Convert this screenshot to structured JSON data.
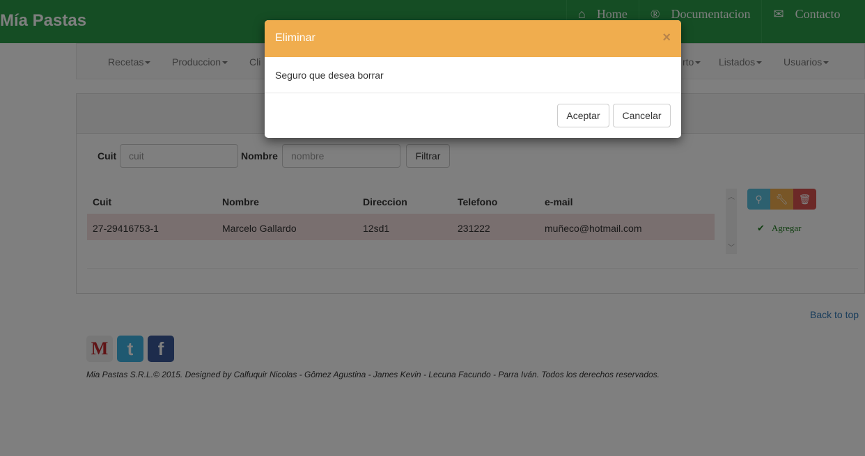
{
  "header": {
    "brand": "Mía Pastas",
    "nav": [
      {
        "icon": "home-icon",
        "label": "Home"
      },
      {
        "icon": "registered-icon",
        "label": "Documentacion"
      },
      {
        "icon": "envelope-icon",
        "label": "Contacto"
      }
    ]
  },
  "subnav": {
    "items": [
      "Recetas",
      "Produccion",
      "Cli",
      "rto",
      "Listados",
      "Usuarios"
    ]
  },
  "filter": {
    "cuit_label": "Cuit",
    "cuit_placeholder": "cuit",
    "nombre_label": "Nombre",
    "nombre_placeholder": "nombre",
    "filter_button": "Filtrar"
  },
  "table": {
    "headers": [
      "Cuit",
      "Nombre",
      "Direccion",
      "Telefono",
      "e-mail"
    ],
    "rows": [
      [
        "27-29416753-1",
        "Marcelo Gallardo",
        "12sd1",
        "231222",
        "muñeco@hotmail.com"
      ]
    ]
  },
  "actions": {
    "add_label": "Agregar",
    "colors": {
      "view": "#5bc0de",
      "edit": "#f0ad4e",
      "delete": "#d9534f"
    }
  },
  "footer": {
    "back_to_top": "Back to top",
    "copyright": "Mia Pastas S.R.L.© 2015. Designed by Calfuquir Nicolas - Gômez Agustina - James Kevin - Lecuna Facundo - Parra Iván. Todos los derechos reservados."
  },
  "modal": {
    "title": "Eliminar",
    "close": "×",
    "message": "Seguro que desea borrar",
    "accept": "Aceptar",
    "cancel": "Cancelar",
    "header_color": "#f0ad4e"
  }
}
